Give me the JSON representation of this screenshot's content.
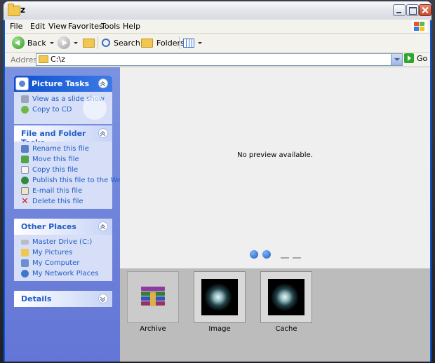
{
  "window": {
    "title": "z"
  },
  "menubar": {
    "items": [
      "File",
      "Edit",
      "View",
      "Favorites",
      "Tools",
      "Help"
    ]
  },
  "toolbar": {
    "back": "Back",
    "search": "Search",
    "folders": "Folders"
  },
  "address": {
    "label": "Address",
    "value": "C:\\z",
    "go": "Go"
  },
  "taskpane": {
    "picture_tasks": {
      "title": "Picture Tasks",
      "items": [
        "View as a slide show",
        "Copy to CD"
      ]
    },
    "file_folder_tasks": {
      "title": "File and Folder Tasks",
      "items": [
        "Rename this file",
        "Move this file",
        "Copy this file",
        "Publish this file to the Web",
        "E-mail this file",
        "Delete this file"
      ]
    },
    "other_places": {
      "title": "Other Places",
      "items": [
        "Master Drive (C:)",
        "My Pictures",
        "My Computer",
        "My Network Places"
      ]
    },
    "details": {
      "title": "Details"
    }
  },
  "preview": {
    "message": "No preview available."
  },
  "filmstrip": {
    "items": [
      {
        "label": "Archive",
        "icon": "winrar-archive-icon",
        "selected": true
      },
      {
        "label": "Image",
        "icon": "image-thumbnail",
        "selected": false
      },
      {
        "label": "Cache",
        "icon": "image-thumbnail",
        "selected": false
      }
    ]
  }
}
